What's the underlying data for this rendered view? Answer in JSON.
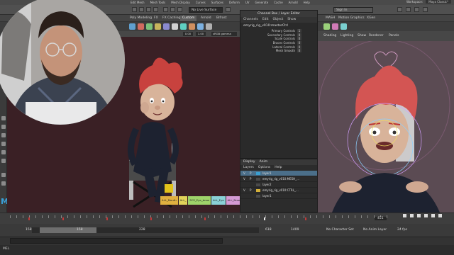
{
  "menubar": {
    "items": [
      "Edit Mesh",
      "Mesh Tools",
      "Mesh Display",
      "Curves",
      "Surfaces",
      "Deform",
      "UV",
      "Generate",
      "Cache",
      "Arnold",
      "Help"
    ],
    "workspace_label": "Workspace:",
    "workspace_value": "Maya Classic*"
  },
  "statusline": {
    "live_surface": "No Live Surface",
    "sign_in": "Sign In"
  },
  "shelf_tabs": [
    "Poly Modeling",
    "FX",
    "FX Caching",
    "Custom",
    "Arnold",
    "Bifrost",
    "MASH",
    "Motion Graphics",
    "XGen"
  ],
  "shelf_active_tab": "Custom",
  "viewport_left": {
    "camera_values": [
      "0.00",
      "1.00"
    ],
    "color_space": "sRGB gamma"
  },
  "viewport_right": {
    "menus": [
      "Shading",
      "Lighting",
      "Show",
      "Renderer",
      "Panels"
    ]
  },
  "channel_box": {
    "title": "Channel Box / Layer Editor",
    "menus": [
      "Channels",
      "Edit",
      "Object",
      "Show"
    ],
    "object_name": "emyrig_rig_v010:masterCtrl",
    "channels": [
      {
        "label": "Primary Controls",
        "value": "1"
      },
      {
        "label": "Secondary Controls",
        "value": "0"
      },
      {
        "label": "Scale Controls",
        "value": "0"
      },
      {
        "label": "Braces Controls",
        "value": "0"
      },
      {
        "label": "Lateral Controls",
        "value": "0"
      },
      {
        "label": "Mesh Smooth",
        "value": "0"
      }
    ]
  },
  "layer_editor": {
    "tabs": [
      "Display",
      "Anim"
    ],
    "menus": [
      "Layers",
      "Options",
      "Help"
    ],
    "layers": [
      {
        "v": "V",
        "p": "P",
        "name": "layer1",
        "color": "#3a9fd0",
        "selected": true
      },
      {
        "v": "V",
        "p": "P",
        "name": "emyrig_rig_v010:MESH_...",
        "color": "#4a4a4a",
        "selected": false
      },
      {
        "v": "",
        "p": "",
        "name": "layer2",
        "color": "#4a4a4a",
        "selected": false
      },
      {
        "v": "V",
        "p": "P",
        "name": "emyrig_rig_v010:CTRL_...",
        "color": "#d4b03a",
        "selected": false
      },
      {
        "v": "",
        "p": "",
        "name": "layer1",
        "color": "#4a4a4a",
        "selected": false
      }
    ]
  },
  "selection_buttons": [
    {
      "label": "ALL_Mouth",
      "color": "#e0b040"
    },
    {
      "label": "ALL_",
      "color": "#e2d35a"
    },
    {
      "label": "SCS_Eye_brow",
      "color": "#9fd36a"
    },
    {
      "label": "ALL_Eye",
      "color": "#8ad0d6"
    },
    {
      "label": "ALL_Brows",
      "color": "#d69ad4"
    }
  ],
  "time_slider": {
    "current_frame": "451"
  },
  "range_slider": {
    "start": "158",
    "range_start": "158",
    "range_end": "228",
    "end": "1409",
    "end2": "618",
    "character_set": "No Character Set",
    "anim_layer": "No Anim Layer",
    "fps": "24 fps"
  },
  "command_line": {
    "mel_label": "MEL"
  }
}
